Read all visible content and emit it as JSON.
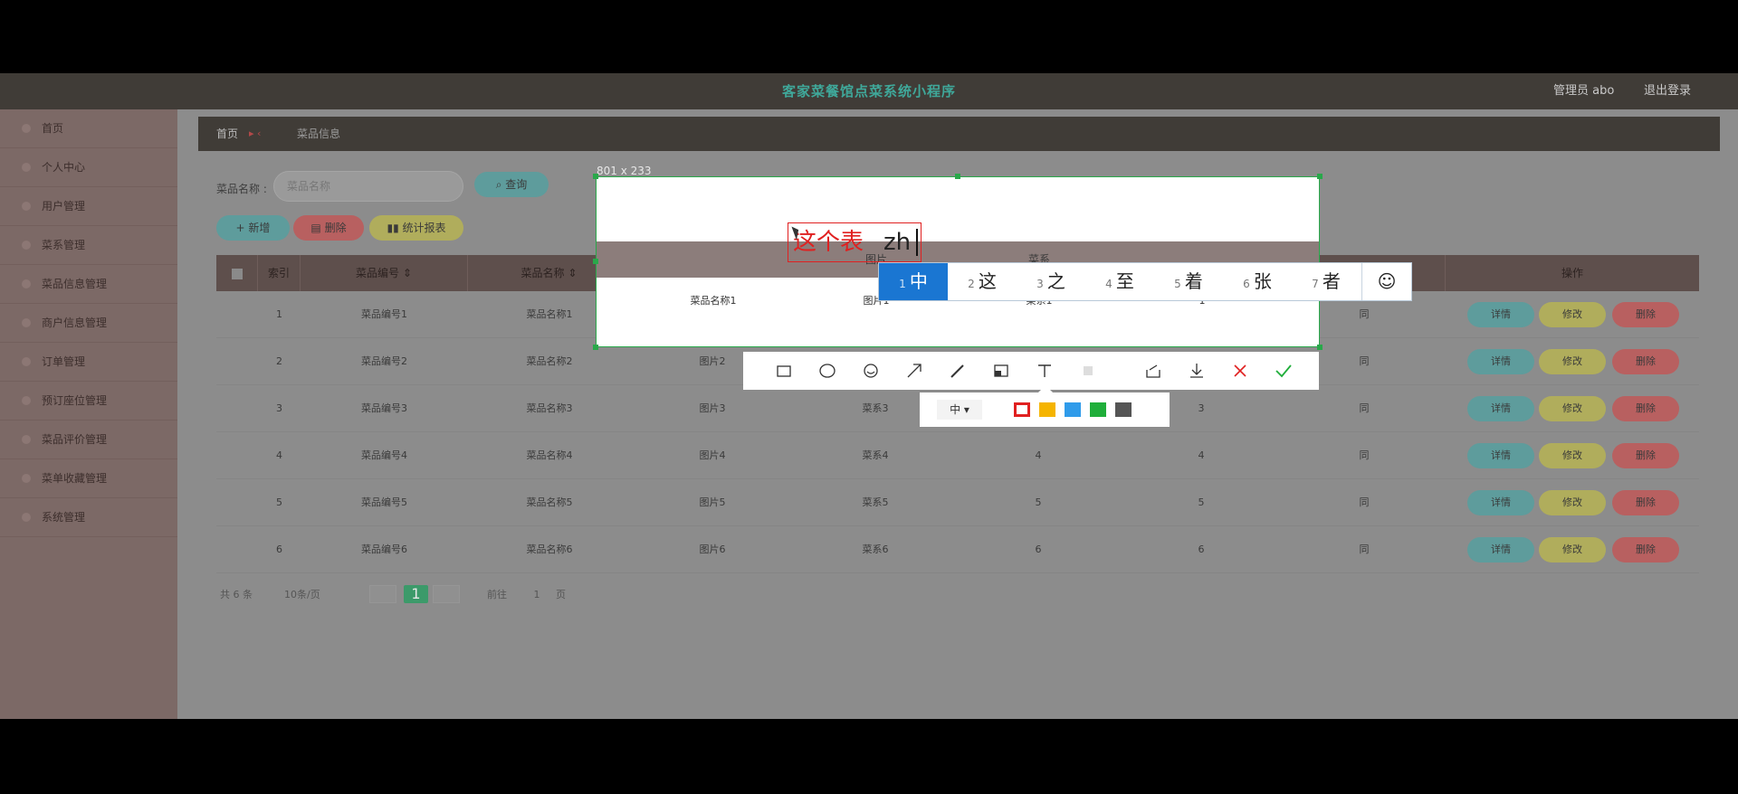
{
  "header": {
    "title": "客家菜餐馆点菜系统小程序",
    "admin": "管理员 abo",
    "logout": "退出登录"
  },
  "sidebar": {
    "items": [
      "首页",
      "个人中心",
      "用户管理",
      "菜系管理",
      "菜品信息管理",
      "商户信息管理",
      "订单管理",
      "预订座位管理",
      "菜品评价管理",
      "菜单收藏管理",
      "系统管理"
    ]
  },
  "breadcrumb": {
    "home": "首页",
    "separator": "▸ ‹",
    "page": "菜品信息"
  },
  "search": {
    "label": "菜品名称",
    "placeholder": "菜品名称",
    "query_button": "查询"
  },
  "actions": {
    "add": "新增",
    "delete": "删除",
    "stats": "统计报表"
  },
  "table": {
    "headers": [
      "索引",
      "菜品编号",
      "菜品名称",
      "图片",
      "菜系",
      "",
      "",
      "",
      "操作"
    ],
    "rows": [
      {
        "index": "1",
        "code": "菜品编号1",
        "name": "菜品名称1",
        "image": "图片1",
        "cuisine": "菜系1",
        "c6": "1",
        "c7": "1",
        "c8": "同"
      },
      {
        "index": "2",
        "code": "菜品编号2",
        "name": "菜品名称2",
        "image": "图片2",
        "cuisine": "菜系2",
        "c6": "2",
        "c7": "2",
        "c8": "同"
      },
      {
        "index": "3",
        "code": "菜品编号3",
        "name": "菜品名称3",
        "image": "图片3",
        "cuisine": "菜系3",
        "c6": "3",
        "c7": "3",
        "c8": "同"
      },
      {
        "index": "4",
        "code": "菜品编号4",
        "name": "菜品名称4",
        "image": "图片4",
        "cuisine": "菜系4",
        "c6": "4",
        "c7": "4",
        "c8": "同"
      },
      {
        "index": "5",
        "code": "菜品编号5",
        "name": "菜品名称5",
        "image": "图片5",
        "cuisine": "菜系5",
        "c6": "5",
        "c7": "5",
        "c8": "同"
      },
      {
        "index": "6",
        "code": "菜品编号6",
        "name": "菜品名称6",
        "image": "图片6",
        "cuisine": "菜系6",
        "c6": "6",
        "c7": "6",
        "c8": "同"
      }
    ],
    "ops": {
      "detail": "详情",
      "edit": "修改",
      "delete": "删除"
    }
  },
  "pagination": {
    "total": "共 6 条",
    "per_page": "10条/页",
    "current": "1",
    "goto": "前往",
    "goto_value": "1",
    "page_unit": "页"
  },
  "capture": {
    "dimensions": "801 x 233",
    "typed_text": "这个表",
    "composition": "zh",
    "preview_headers": [
      "图片",
      "菜系"
    ],
    "preview_row": [
      "菜品名称1",
      "图片1",
      "菜系1",
      "1",
      "1"
    ]
  },
  "ime": {
    "candidates": [
      {
        "num": "1",
        "char": "中"
      },
      {
        "num": "2",
        "char": "这"
      },
      {
        "num": "3",
        "char": "之"
      },
      {
        "num": "4",
        "char": "至"
      },
      {
        "num": "5",
        "char": "着"
      },
      {
        "num": "6",
        "char": "张"
      },
      {
        "num": "7",
        "char": "者"
      }
    ],
    "emoji": "☺"
  },
  "toolbar": {
    "tools": [
      "rectangle-icon",
      "ellipse-icon",
      "marker-icon",
      "arrow-icon",
      "pen-icon",
      "mosaic-icon",
      "text-icon",
      "undo-icon",
      "share-icon",
      "download-icon",
      "cancel-icon",
      "confirm-icon"
    ]
  },
  "style": {
    "size": "中 ▾",
    "colors": [
      "#e02020",
      "#f5b400",
      "#2f9bea",
      "#1fae3a",
      "#555555"
    ]
  }
}
